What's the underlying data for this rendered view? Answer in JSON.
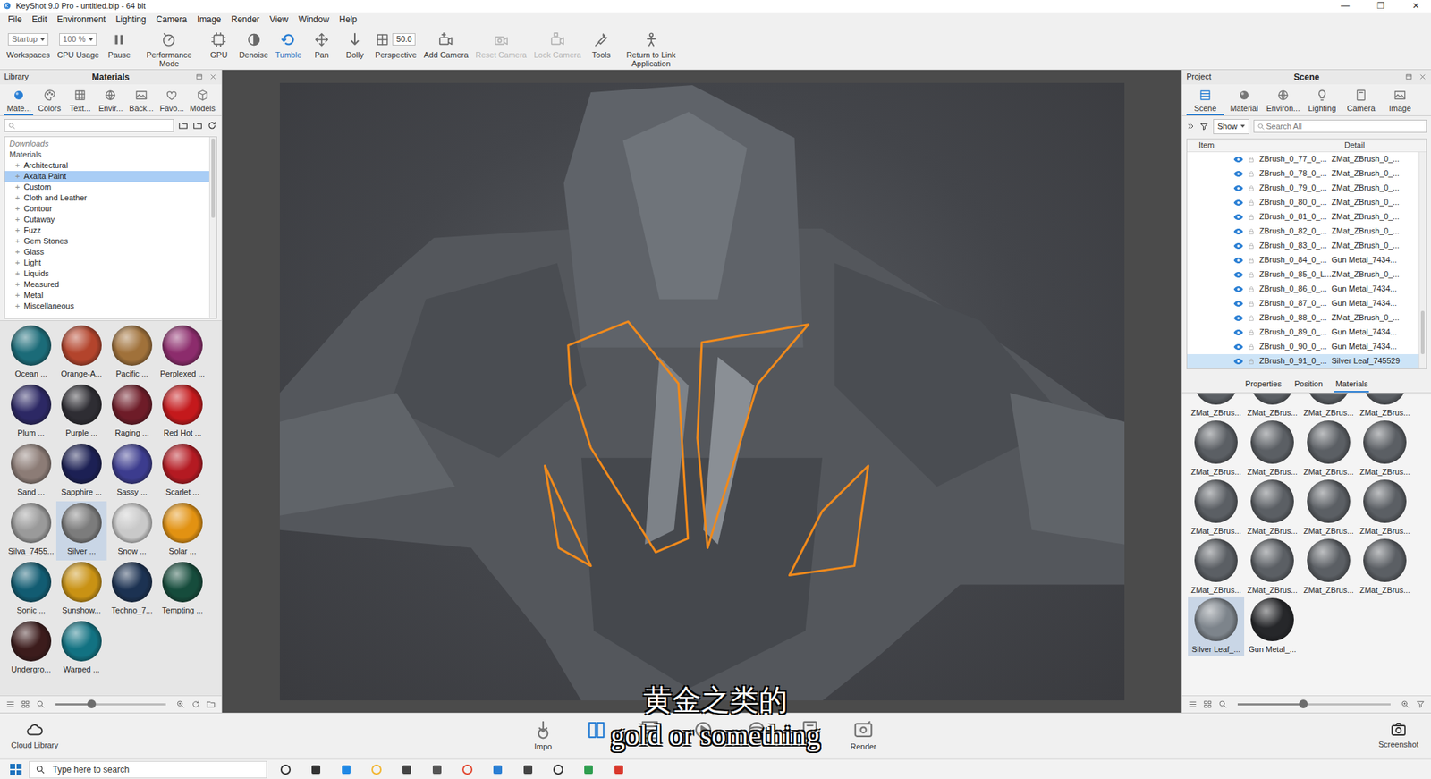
{
  "window": {
    "title": "KeyShot 9.0 Pro - untitled.bip - 64 bit",
    "controls": [
      "—",
      "❐",
      "✕"
    ]
  },
  "menu": [
    "File",
    "Edit",
    "Environment",
    "Lighting",
    "Camera",
    "Image",
    "Render",
    "View",
    "Window",
    "Help"
  ],
  "toolbar": [
    {
      "label": "Workspaces",
      "value": "Startup",
      "kind": "dropdown",
      "selected": false,
      "disabled": false
    },
    {
      "label": "CPU Usage",
      "value": "100 %",
      "kind": "dropdown",
      "selected": false,
      "disabled": false
    },
    {
      "label": "Pause",
      "kind": "button",
      "selected": false,
      "disabled": false
    },
    {
      "label": "Performance Mode",
      "kind": "button",
      "selected": false,
      "disabled": false
    },
    {
      "label": "GPU",
      "kind": "button",
      "selected": false,
      "disabled": false
    },
    {
      "label": "Denoise",
      "kind": "button",
      "selected": false,
      "disabled": false
    },
    {
      "label": "Tumble",
      "kind": "button",
      "selected": true,
      "disabled": false
    },
    {
      "label": "Pan",
      "kind": "button",
      "selected": false,
      "disabled": false
    },
    {
      "label": "Dolly",
      "kind": "button",
      "selected": false,
      "disabled": false
    },
    {
      "label": "Perspective",
      "value": "50.0",
      "kind": "field",
      "selected": false,
      "disabled": false
    },
    {
      "label": "Add Camera",
      "kind": "button",
      "selected": false,
      "disabled": false
    },
    {
      "label": "Reset Camera",
      "kind": "button",
      "selected": false,
      "disabled": true
    },
    {
      "label": "Lock Camera",
      "kind": "button",
      "selected": false,
      "disabled": true
    },
    {
      "label": "Tools",
      "kind": "button",
      "selected": false,
      "disabled": false
    },
    {
      "label": "Return to Link Application",
      "kind": "button",
      "selected": false,
      "disabled": false
    }
  ],
  "left_panel": {
    "title": "Library",
    "heading": "Materials",
    "tabs": [
      {
        "label": "Mate...",
        "selected": true
      },
      {
        "label": "Colors",
        "selected": false
      },
      {
        "label": "Text...",
        "selected": false
      },
      {
        "label": "Envir...",
        "selected": false
      },
      {
        "label": "Back...",
        "selected": false
      },
      {
        "label": "Favo...",
        "selected": false
      },
      {
        "label": "Models",
        "selected": false
      }
    ],
    "tree": [
      {
        "label": "Downloads",
        "kind": "header",
        "selected": false
      },
      {
        "label": "Materials",
        "kind": "header",
        "selected": false
      },
      {
        "label": "Architectural",
        "kind": "category",
        "expander": "+",
        "selected": false
      },
      {
        "label": "Axalta Paint",
        "kind": "category",
        "expander": "+",
        "selected": true
      },
      {
        "label": "Custom",
        "kind": "category",
        "expander": "+",
        "selected": false
      },
      {
        "label": "Cloth and Leather",
        "kind": "category",
        "expander": "+",
        "selected": false
      },
      {
        "label": "Contour",
        "kind": "category",
        "expander": "+",
        "selected": false
      },
      {
        "label": "Cutaway",
        "kind": "category",
        "expander": "+",
        "selected": false
      },
      {
        "label": "Fuzz",
        "kind": "category",
        "expander": "+",
        "selected": false
      },
      {
        "label": "Gem Stones",
        "kind": "category",
        "expander": "+",
        "selected": false
      },
      {
        "label": "Glass",
        "kind": "category",
        "expander": "+",
        "selected": false
      },
      {
        "label": "Light",
        "kind": "category",
        "expander": "+",
        "selected": false
      },
      {
        "label": "Liquids",
        "kind": "category",
        "expander": "+",
        "selected": false
      },
      {
        "label": "Measured",
        "kind": "category",
        "expander": "+",
        "selected": false
      },
      {
        "label": "Metal",
        "kind": "category",
        "expander": "+",
        "selected": false
      },
      {
        "label": "Miscellaneous",
        "kind": "category",
        "expander": "+",
        "selected": false
      }
    ],
    "thumbnails": [
      {
        "name": "Ocean ...",
        "color": "#1b6b78",
        "selected": false
      },
      {
        "name": "Orange-A...",
        "color": "#b3442c",
        "selected": false
      },
      {
        "name": "Pacific ...",
        "color": "#a0713a",
        "selected": false
      },
      {
        "name": "Perplexed ...",
        "color": "#8c2c6c",
        "selected": false
      },
      {
        "name": "Plum ...",
        "color": "#2c2864",
        "selected": false
      },
      {
        "name": "Purple ...",
        "color": "#2e2d33",
        "selected": false
      },
      {
        "name": "Raging ...",
        "color": "#6e1c28",
        "selected": false
      },
      {
        "name": "Red Hot ...",
        "color": "#c4191c",
        "selected": false
      },
      {
        "name": "Sand ...",
        "color": "#8c7c76",
        "selected": false
      },
      {
        "name": "Sapphire ...",
        "color": "#1c2054",
        "selected": false
      },
      {
        "name": "Sassy ...",
        "color": "#3c3c8e",
        "selected": false
      },
      {
        "name": "Scarlet ...",
        "color": "#b41a22",
        "selected": false
      },
      {
        "name": "Silva_7455...",
        "color": "#9a9a9a",
        "selected": false
      },
      {
        "name": "Silver ...",
        "color": "#7c7c7c",
        "selected": true
      },
      {
        "name": "Snow ...",
        "color": "#c9c9c9",
        "selected": false
      },
      {
        "name": "Solar ...",
        "color": "#e29212",
        "selected": false
      },
      {
        "name": "Sonic ...",
        "color": "#125c72",
        "selected": false
      },
      {
        "name": "Sunshow...",
        "color": "#c99214",
        "selected": false
      },
      {
        "name": "Techno_7...",
        "color": "#1c3252",
        "selected": false
      },
      {
        "name": "Tempting ...",
        "color": "#164c3c",
        "selected": false
      },
      {
        "name": "Undergro...",
        "color": "#3c1c1c",
        "selected": false
      },
      {
        "name": "Warped ...",
        "color": "#127282",
        "selected": false
      }
    ],
    "size_slider": {
      "level": 0.33
    },
    "cloud": "Cloud Library"
  },
  "right_panel": {
    "title": "Project",
    "heading": "Scene",
    "tabs": [
      {
        "label": "Scene",
        "selected": true
      },
      {
        "label": "Material",
        "selected": false
      },
      {
        "label": "Environ...",
        "selected": false
      },
      {
        "label": "Lighting",
        "selected": false
      },
      {
        "label": "Camera",
        "selected": false
      },
      {
        "label": "Image",
        "selected": false
      }
    ],
    "show": "Show",
    "search_placeholder": "Search All",
    "columns": [
      "Item",
      "Detail"
    ],
    "rows": [
      {
        "item": "ZBrush_0_77_0_...",
        "detail": "ZMat_ZBrush_0_...",
        "visible": true,
        "selected": false
      },
      {
        "item": "ZBrush_0_78_0_...",
        "detail": "ZMat_ZBrush_0_...",
        "visible": true,
        "selected": false
      },
      {
        "item": "ZBrush_0_79_0_...",
        "detail": "ZMat_ZBrush_0_...",
        "visible": true,
        "selected": false
      },
      {
        "item": "ZBrush_0_80_0_...",
        "detail": "ZMat_ZBrush_0_...",
        "visible": true,
        "selected": false
      },
      {
        "item": "ZBrush_0_81_0_...",
        "detail": "ZMat_ZBrush_0_...",
        "visible": true,
        "selected": false
      },
      {
        "item": "ZBrush_0_82_0_...",
        "detail": "ZMat_ZBrush_0_...",
        "visible": true,
        "selected": false
      },
      {
        "item": "ZBrush_0_83_0_...",
        "detail": "ZMat_ZBrush_0_...",
        "visible": true,
        "selected": false
      },
      {
        "item": "ZBrush_0_84_0_...",
        "detail": "Gun Metal_7434...",
        "visible": true,
        "selected": false
      },
      {
        "item": "ZBrush_0_85_0_L...",
        "detail": "ZMat_ZBrush_0_...",
        "visible": true,
        "selected": false
      },
      {
        "item": "ZBrush_0_86_0_...",
        "detail": "Gun Metal_7434...",
        "visible": true,
        "selected": false
      },
      {
        "item": "ZBrush_0_87_0_...",
        "detail": "Gun Metal_7434...",
        "visible": true,
        "selected": false
      },
      {
        "item": "ZBrush_0_88_0_...",
        "detail": "ZMat_ZBrush_0_...",
        "visible": true,
        "selected": false
      },
      {
        "item": "ZBrush_0_89_0_...",
        "detail": "Gun Metal_7434...",
        "visible": true,
        "selected": false
      },
      {
        "item": "ZBrush_0_90_0_...",
        "detail": "Gun Metal_7434...",
        "visible": true,
        "selected": false
      },
      {
        "item": "ZBrush_0_91_0_...",
        "detail": "Silver Leaf_745529",
        "visible": true,
        "selected": true
      }
    ],
    "sub_tabs": [
      {
        "label": "Properties",
        "selected": false
      },
      {
        "label": "Position",
        "selected": false
      },
      {
        "label": "Materials",
        "selected": true
      }
    ],
    "materials": [
      {
        "name": "ZMat_ZBrus...",
        "color": "#5b5f64",
        "selected": false
      },
      {
        "name": "ZMat_ZBrus...",
        "color": "#5b5f64",
        "selected": false
      },
      {
        "name": "ZMat_ZBrus...",
        "color": "#5b5f64",
        "selected": false
      },
      {
        "name": "ZMat_ZBrus...",
        "color": "#5b5f64",
        "selected": false
      },
      {
        "name": "ZMat_ZBrus...",
        "color": "#5b5f64",
        "selected": false
      },
      {
        "name": "ZMat_ZBrus...",
        "color": "#5b5f64",
        "selected": false
      },
      {
        "name": "ZMat_ZBrus...",
        "color": "#5b5f64",
        "selected": false
      },
      {
        "name": "ZMat_ZBrus...",
        "color": "#5b5f64",
        "selected": false
      },
      {
        "name": "ZMat_ZBrus...",
        "color": "#5b5f64",
        "selected": false
      },
      {
        "name": "ZMat_ZBrus...",
        "color": "#5b5f64",
        "selected": false
      },
      {
        "name": "ZMat_ZBrus...",
        "color": "#5b5f64",
        "selected": false
      },
      {
        "name": "ZMat_ZBrus...",
        "color": "#5b5f64",
        "selected": false
      },
      {
        "name": "ZMat_ZBrus...",
        "color": "#5b5f64",
        "selected": false
      },
      {
        "name": "ZMat_ZBrus...",
        "color": "#5b5f64",
        "selected": false
      },
      {
        "name": "ZMat_ZBrus...",
        "color": "#5b5f64",
        "selected": false
      },
      {
        "name": "ZMat_ZBrus...",
        "color": "#5b5f64",
        "selected": false
      },
      {
        "name": "Silver Leaf_...",
        "color": "#7d848b",
        "selected": true
      },
      {
        "name": "Gun Metal_...",
        "color": "#26272a",
        "selected": false
      }
    ],
    "size_slider": {
      "level": 0.43
    }
  },
  "bottom_bar": {
    "tools": [
      {
        "label": "Impo",
        "selected": false
      },
      {
        "selected": true
      },
      {
        "selected": false
      },
      {
        "selected": false
      },
      {
        "selected": false
      },
      {
        "selected": false
      },
      {
        "label": "Render",
        "selected": false
      }
    ],
    "screenshot": "Screenshot"
  },
  "subtitles": [
    "黄金之类的",
    "gold or something"
  ],
  "taskbar": {
    "search_placeholder": "Type here to search"
  }
}
